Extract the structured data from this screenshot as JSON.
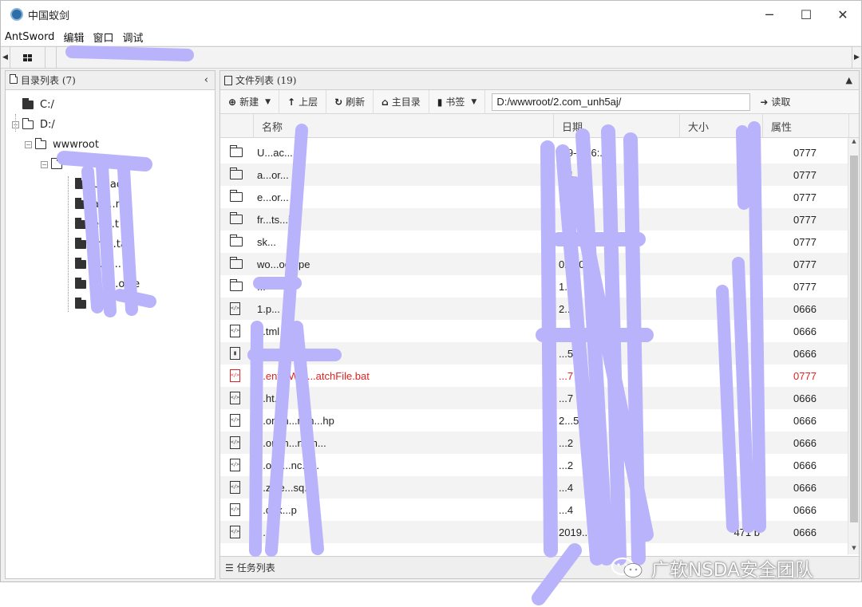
{
  "window": {
    "title": "中国蚁剑",
    "controls": [
      "─",
      "☐",
      "✕"
    ]
  },
  "menu": [
    "AntSword",
    "编辑",
    "窗口",
    "调试"
  ],
  "left_panel": {
    "title": "目录列表 (7)",
    "tree": [
      {
        "label": "C:/",
        "depth": 0,
        "toggle": ""
      },
      {
        "label": "D:/",
        "depth": 0,
        "toggle": "−"
      },
      {
        "label": "wwwroot",
        "depth": 1,
        "toggle": "−"
      },
      {
        "label": "",
        "depth": 2,
        "toggle": "−"
      },
      {
        "label": "U...ad",
        "depth": 3,
        "toggle": ""
      },
      {
        "label": "ad...ns",
        "depth": 3,
        "toggle": ""
      },
      {
        "label": "ex...t",
        "depth": 3,
        "toggle": ""
      },
      {
        "label": "fro...ta",
        "depth": 3,
        "toggle": ""
      },
      {
        "label": "...ki...",
        "depth": 3,
        "toggle": ""
      },
      {
        "label": "...k...ollie",
        "depth": 3,
        "toggle": ""
      },
      {
        "label": "",
        "depth": 3,
        "toggle": ""
      }
    ]
  },
  "right_panel": {
    "title": "文件列表 (19)",
    "toolbar": {
      "new": "新建",
      "up": "上层",
      "refresh": "刷新",
      "home": "主目录",
      "bookmark": "书签",
      "read": "读取"
    },
    "path": "D:/wwwroot/2.com_unh5aj/",
    "columns": [
      "名称",
      "日期",
      "大小",
      "属性"
    ],
    "files": [
      {
        "type": "folder",
        "name": "U...ac...",
        "date": "...9-0...6:...6",
        "size": "",
        "perm": "0777",
        "red": false
      },
      {
        "type": "folder",
        "name": "a...or...",
        "date": "...4",
        "size": "",
        "perm": "0777",
        "red": false
      },
      {
        "type": "folder",
        "name": "e...or...",
        "date": "...5",
        "size": "",
        "perm": "0777",
        "red": false
      },
      {
        "type": "folder",
        "name": "fr...ts...ic",
        "date": "",
        "size": "",
        "perm": "0777",
        "red": false
      },
      {
        "type": "folder",
        "name": "sk...",
        "date": "0...",
        "size": "",
        "perm": "0777",
        "red": false
      },
      {
        "type": "folder",
        "name": "wo...oc...pe",
        "date": "02...0",
        "size": "",
        "perm": "0777",
        "red": false
      },
      {
        "type": "folder",
        "name": "...",
        "date": "1...",
        "size": "",
        "perm": "0777",
        "red": false
      },
      {
        "type": "code",
        "name": "1.p...",
        "date": "2...",
        "size": "",
        "perm": "0666",
        "red": false
      },
      {
        "type": "code",
        "name": "...tml",
        "date": "2...5",
        "size": "",
        "perm": "0666",
        "red": false
      },
      {
        "type": "zip",
        "name": "...",
        "date": "...5",
        "size": "",
        "perm": "0666",
        "red": false
      },
      {
        "type": "code",
        "name": "...ent...Wm...atchFile.bat",
        "date": "...7",
        "size": "",
        "perm": "0777",
        "red": true
      },
      {
        "type": "code",
        "name": "...ht...",
        "date": "...7",
        "size": "",
        "perm": "0666",
        "red": false
      },
      {
        "type": "code",
        "name": "...omm...n.in...hp",
        "date": "2...5",
        "size": "",
        "perm": "0666",
        "red": false
      },
      {
        "type": "code",
        "name": "...omm...n.ph...",
        "date": "...2",
        "size": "",
        "perm": "0666",
        "red": false
      },
      {
        "type": "code",
        "name": "...onfi...nc.p...",
        "date": "...2",
        "size": "",
        "perm": "0666",
        "red": false
      },
      {
        "type": "code",
        "name": "...z_le...sq...",
        "date": "...4",
        "size": "",
        "perm": "0666",
        "red": false
      },
      {
        "type": "code",
        "name": "...dex...p",
        "date": "...4",
        "size": "",
        "perm": "0666",
        "red": false
      },
      {
        "type": "code",
        "name": "...",
        "date": "2019...49",
        "size": "471 b",
        "perm": "0666",
        "red": false
      }
    ],
    "task_bar": "任务列表"
  },
  "watermark": "广软NSDA安全团队",
  "colors": {
    "redaction": "#b9b3fb",
    "error_red": "#e02222"
  }
}
